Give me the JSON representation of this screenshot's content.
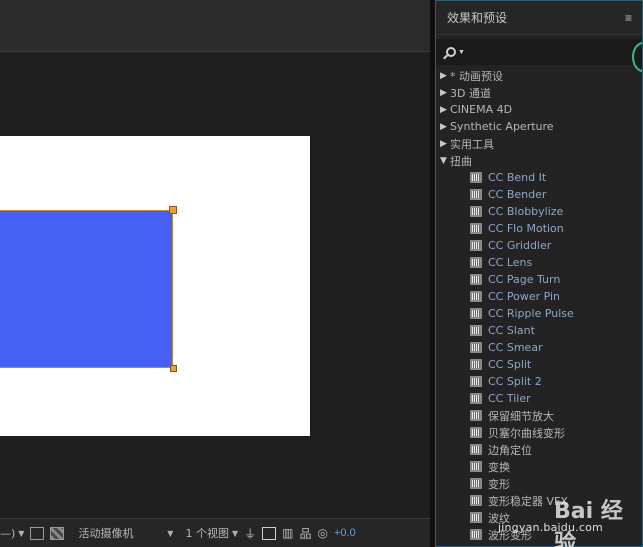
{
  "comp_toolbar": {
    "fragment": "—)",
    "camera": "活动摄像机",
    "views": "1 个视图",
    "exposure": "+0.0"
  },
  "effects_panel": {
    "title": "效果和预设",
    "menu_glyph": "≡",
    "categories_top": [
      {
        "label": "* 动画预设"
      },
      {
        "label": "3D 通道"
      },
      {
        "label": "CINEMA 4D"
      },
      {
        "label": "Synthetic Aperture"
      },
      {
        "label": "实用工具"
      }
    ],
    "open_category": {
      "label": "扭曲"
    },
    "items": [
      {
        "label": "CC Bend It"
      },
      {
        "label": "CC Bender"
      },
      {
        "label": "CC Blobbylize"
      },
      {
        "label": "CC Flo Motion"
      },
      {
        "label": "CC Griddler"
      },
      {
        "label": "CC Lens"
      },
      {
        "label": "CC Page Turn"
      },
      {
        "label": "CC Power Pin"
      },
      {
        "label": "CC Ripple Pulse"
      },
      {
        "label": "CC Slant"
      },
      {
        "label": "CC Smear"
      },
      {
        "label": "CC Split"
      },
      {
        "label": "CC Split 2"
      },
      {
        "label": "CC Tiler"
      },
      {
        "label": "保留细节放大"
      },
      {
        "label": "贝塞尔曲线变形"
      },
      {
        "label": "边角定位"
      },
      {
        "label": "变换"
      },
      {
        "label": "变形"
      },
      {
        "label": "变形稳定器 VFX"
      },
      {
        "label": "波纹"
      },
      {
        "label": "波形变形"
      }
    ]
  },
  "watermark": {
    "logo": "Bai 经验",
    "url": "jingyan.baidu.com"
  },
  "colors": {
    "shape_fill": "#4560f2",
    "shape_border": "#c9892c",
    "handle": "#f0a030",
    "panel_border": "#2b5f78",
    "exposure_text": "#5fa0e0"
  }
}
